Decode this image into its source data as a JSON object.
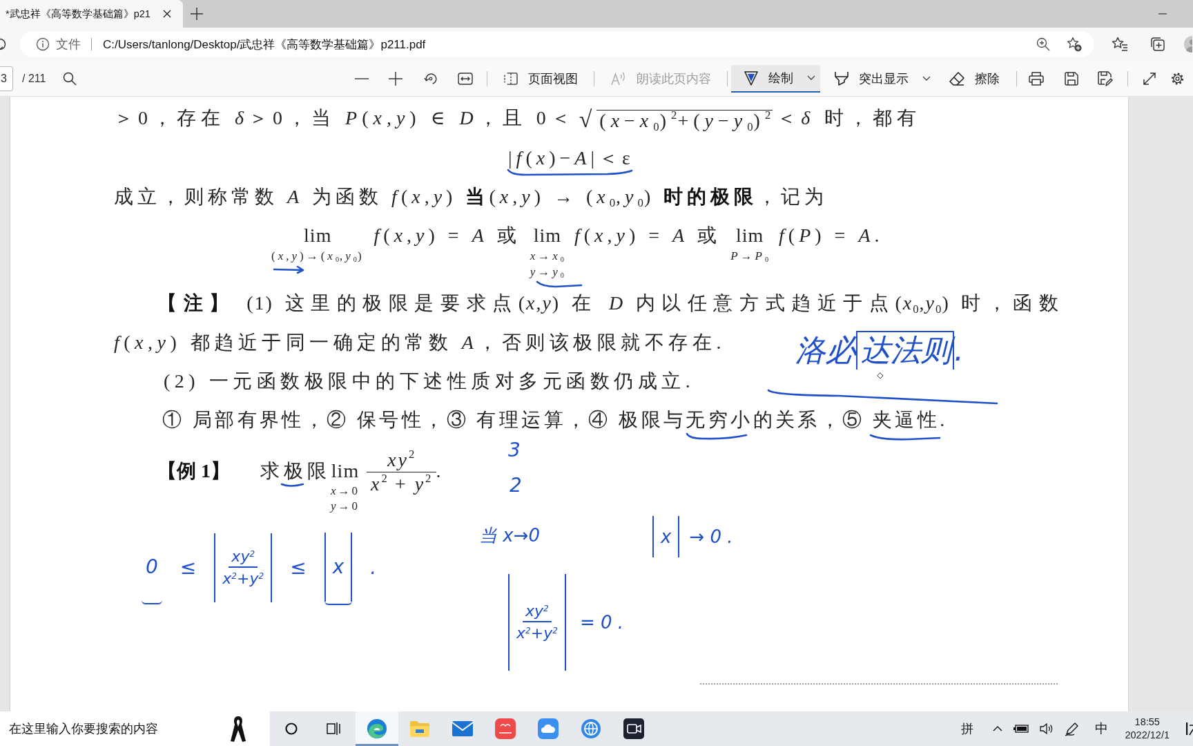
{
  "browser": {
    "tabs": [
      {
        "title": "*武忠祥《高等数学基础篇》p21",
        "selected": true
      }
    ],
    "address_bar": {
      "site_label": "文件",
      "url": "C:/Users/tanlong/Desktop/武忠祥《高等数学基础篇》p211.pdf"
    }
  },
  "pdf_toolbar": {
    "page_number": "3",
    "page_count": "/ 211",
    "tools": [
      {
        "label": "页面视图",
        "selected": false,
        "disabled": false,
        "dropdown": false
      },
      {
        "label": "朗读此页内容",
        "selected": false,
        "disabled": true,
        "dropdown": false
      },
      {
        "label": "绘制",
        "selected": true,
        "disabled": false,
        "dropdown": true
      },
      {
        "label": "突出显示",
        "selected": false,
        "disabled": false,
        "dropdown": true
      },
      {
        "label": "擦除",
        "selected": false,
        "disabled": false,
        "dropdown": false
      }
    ]
  },
  "document": {
    "definition_line": [
      {
        "kind": "text",
        "text": "＞0，存在 *δ*＞0，当 *P*(*x*,*y*) ∈ *D*，且 0＜"
      },
      {
        "kind": "sqrt",
        "sign": "√",
        "radicand": "(*x*−*x*$_{0}$)$^{2}$+(*y*−*y*$_{0}$)$^{2}$"
      },
      {
        "kind": "text",
        "text": "＜*δ* 时，都有"
      }
    ],
    "inequality": "|*f*(*x*)−*A*|＜ε",
    "conclusion": "成立，则称常数 *A* 为函数 *f*(*x*,*y*) **当**(*x*,*y*) → (*x*$_{0}$,*y*$_{0}$) **时的极限**，记为",
    "formula": [
      {
        "kind": "lim",
        "op": "lim",
        "under": [
          "(*x*,*y*)→(*x*$_{0}$,*y*$_{0}$)"
        ]
      },
      {
        "kind": "text",
        "text": "*f*(*x*,*y*) = *A* 或"
      },
      {
        "kind": "lim",
        "op": "lim",
        "under": [
          "*x*→*x*$_{0}$",
          "*y*→*y*$_{0}$"
        ]
      },
      {
        "kind": "text",
        "text": "*f*(*x*,*y*) = *A* 或"
      },
      {
        "kind": "lim",
        "op": "lim",
        "under": [
          "*P*→*P*$_{0}$"
        ]
      },
      {
        "kind": "text",
        "text": "*f*(*P*) = *A*."
      }
    ],
    "note": {
      "lines": [
        "**【注】** (1) 这里的极限是要求点(*x*,*y*) 在 *D* 内以任意方式趋近于点(*x*$_{0}$,*y*$_{0}$) 时，函数",
        "*f*(*x*,*y*) 都趋近于同一确定的常数 *A*，否则该极限就不存在."
      ]
    },
    "note_2": "(2) 一元函数极限中的下述性质对多元函数仍成立.",
    "properties": "① 局部有界性，② 保号性，③ 有理运算，④ 极限与无穷小的关系，⑤ 夹逼性.",
    "example": {
      "label": "【例 1】",
      "prompt": "求极限",
      "lim": {
        "op": "lim",
        "under": [
          "*x*→0",
          "*y*→0"
        ]
      },
      "numerator": "*xy*$^{2}$",
      "denominator": "*x*$^{2}$ + *y*$^{2}$",
      "end": "."
    }
  },
  "handwriting": {
    "note": [
      {
        "kind": "text",
        "text": "洛必"
      },
      {
        "kind": "bracketed",
        "text": "达法则"
      },
      {
        "kind": "text",
        "text": "."
      }
    ],
    "numbers": [
      "3",
      "2"
    ],
    "inequality": [
      {
        "kind": "text",
        "text": "0",
        "underlined": true
      },
      {
        "kind": "text",
        "text": "≤",
        "underlined": false
      },
      {
        "kind": "abs_fraction",
        "numerator": "xy$^{2}$",
        "denominator": "x$^{2}$+y$^{2}$",
        "underlined": false
      },
      {
        "kind": "text",
        "text": "≤",
        "underlined": false
      },
      {
        "kind": "abs",
        "text": "x",
        "underlined": true
      },
      {
        "kind": "text",
        "text": ".",
        "underlined": false
      }
    ],
    "condition": "当 x→0",
    "limit": [
      {
        "kind": "abs",
        "text": "x"
      },
      {
        "kind": "text",
        "text": "→ 0 ."
      }
    ],
    "result": [
      {
        "kind": "abs_fraction",
        "numerator": "xy$^{2}$",
        "denominator": "x$^{2}$+y$^{2}$"
      },
      {
        "kind": "text",
        "text": "= 0 ."
      }
    ]
  },
  "taskbar": {
    "search_placeholder": "在这里输入你要搜索的内容",
    "apps": [
      {
        "active": true
      },
      {
        "active": false
      },
      {
        "active": false
      },
      {
        "active": false
      },
      {
        "active": false
      },
      {
        "active": false
      },
      {
        "active": false
      }
    ],
    "ime_mode": "拼",
    "input_language": "中",
    "time": "18:55",
    "date": "2022/12/1"
  }
}
